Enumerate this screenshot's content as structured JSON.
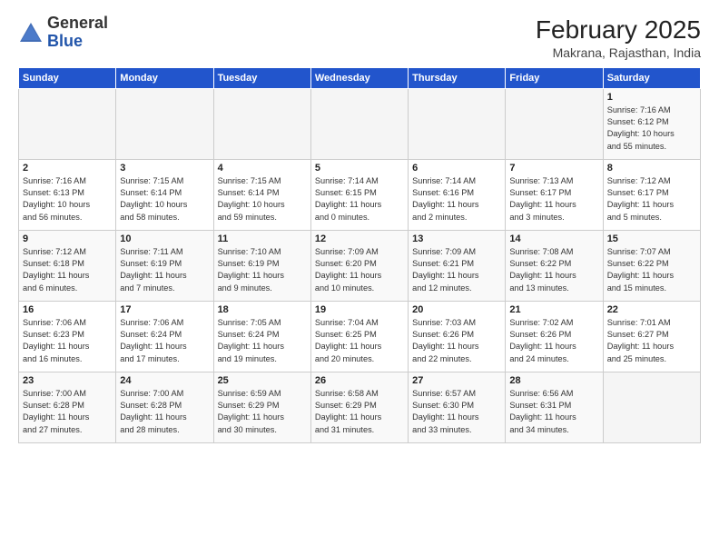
{
  "header": {
    "logo_general": "General",
    "logo_blue": "Blue",
    "month_title": "February 2025",
    "location": "Makrana, Rajasthan, India"
  },
  "days_of_week": [
    "Sunday",
    "Monday",
    "Tuesday",
    "Wednesday",
    "Thursday",
    "Friday",
    "Saturday"
  ],
  "weeks": [
    {
      "days": [
        {
          "num": "",
          "content": ""
        },
        {
          "num": "",
          "content": ""
        },
        {
          "num": "",
          "content": ""
        },
        {
          "num": "",
          "content": ""
        },
        {
          "num": "",
          "content": ""
        },
        {
          "num": "",
          "content": ""
        },
        {
          "num": "1",
          "content": "Sunrise: 7:16 AM\nSunset: 6:12 PM\nDaylight: 10 hours\nand 55 minutes."
        }
      ]
    },
    {
      "days": [
        {
          "num": "2",
          "content": "Sunrise: 7:16 AM\nSunset: 6:13 PM\nDaylight: 10 hours\nand 56 minutes."
        },
        {
          "num": "3",
          "content": "Sunrise: 7:15 AM\nSunset: 6:14 PM\nDaylight: 10 hours\nand 58 minutes."
        },
        {
          "num": "4",
          "content": "Sunrise: 7:15 AM\nSunset: 6:14 PM\nDaylight: 10 hours\nand 59 minutes."
        },
        {
          "num": "5",
          "content": "Sunrise: 7:14 AM\nSunset: 6:15 PM\nDaylight: 11 hours\nand 0 minutes."
        },
        {
          "num": "6",
          "content": "Sunrise: 7:14 AM\nSunset: 6:16 PM\nDaylight: 11 hours\nand 2 minutes."
        },
        {
          "num": "7",
          "content": "Sunrise: 7:13 AM\nSunset: 6:17 PM\nDaylight: 11 hours\nand 3 minutes."
        },
        {
          "num": "8",
          "content": "Sunrise: 7:12 AM\nSunset: 6:17 PM\nDaylight: 11 hours\nand 5 minutes."
        }
      ]
    },
    {
      "days": [
        {
          "num": "9",
          "content": "Sunrise: 7:12 AM\nSunset: 6:18 PM\nDaylight: 11 hours\nand 6 minutes."
        },
        {
          "num": "10",
          "content": "Sunrise: 7:11 AM\nSunset: 6:19 PM\nDaylight: 11 hours\nand 7 minutes."
        },
        {
          "num": "11",
          "content": "Sunrise: 7:10 AM\nSunset: 6:19 PM\nDaylight: 11 hours\nand 9 minutes."
        },
        {
          "num": "12",
          "content": "Sunrise: 7:09 AM\nSunset: 6:20 PM\nDaylight: 11 hours\nand 10 minutes."
        },
        {
          "num": "13",
          "content": "Sunrise: 7:09 AM\nSunset: 6:21 PM\nDaylight: 11 hours\nand 12 minutes."
        },
        {
          "num": "14",
          "content": "Sunrise: 7:08 AM\nSunset: 6:22 PM\nDaylight: 11 hours\nand 13 minutes."
        },
        {
          "num": "15",
          "content": "Sunrise: 7:07 AM\nSunset: 6:22 PM\nDaylight: 11 hours\nand 15 minutes."
        }
      ]
    },
    {
      "days": [
        {
          "num": "16",
          "content": "Sunrise: 7:06 AM\nSunset: 6:23 PM\nDaylight: 11 hours\nand 16 minutes."
        },
        {
          "num": "17",
          "content": "Sunrise: 7:06 AM\nSunset: 6:24 PM\nDaylight: 11 hours\nand 17 minutes."
        },
        {
          "num": "18",
          "content": "Sunrise: 7:05 AM\nSunset: 6:24 PM\nDaylight: 11 hours\nand 19 minutes."
        },
        {
          "num": "19",
          "content": "Sunrise: 7:04 AM\nSunset: 6:25 PM\nDaylight: 11 hours\nand 20 minutes."
        },
        {
          "num": "20",
          "content": "Sunrise: 7:03 AM\nSunset: 6:26 PM\nDaylight: 11 hours\nand 22 minutes."
        },
        {
          "num": "21",
          "content": "Sunrise: 7:02 AM\nSunset: 6:26 PM\nDaylight: 11 hours\nand 24 minutes."
        },
        {
          "num": "22",
          "content": "Sunrise: 7:01 AM\nSunset: 6:27 PM\nDaylight: 11 hours\nand 25 minutes."
        }
      ]
    },
    {
      "days": [
        {
          "num": "23",
          "content": "Sunrise: 7:00 AM\nSunset: 6:28 PM\nDaylight: 11 hours\nand 27 minutes."
        },
        {
          "num": "24",
          "content": "Sunrise: 7:00 AM\nSunset: 6:28 PM\nDaylight: 11 hours\nand 28 minutes."
        },
        {
          "num": "25",
          "content": "Sunrise: 6:59 AM\nSunset: 6:29 PM\nDaylight: 11 hours\nand 30 minutes."
        },
        {
          "num": "26",
          "content": "Sunrise: 6:58 AM\nSunset: 6:29 PM\nDaylight: 11 hours\nand 31 minutes."
        },
        {
          "num": "27",
          "content": "Sunrise: 6:57 AM\nSunset: 6:30 PM\nDaylight: 11 hours\nand 33 minutes."
        },
        {
          "num": "28",
          "content": "Sunrise: 6:56 AM\nSunset: 6:31 PM\nDaylight: 11 hours\nand 34 minutes."
        },
        {
          "num": "",
          "content": ""
        }
      ]
    }
  ]
}
